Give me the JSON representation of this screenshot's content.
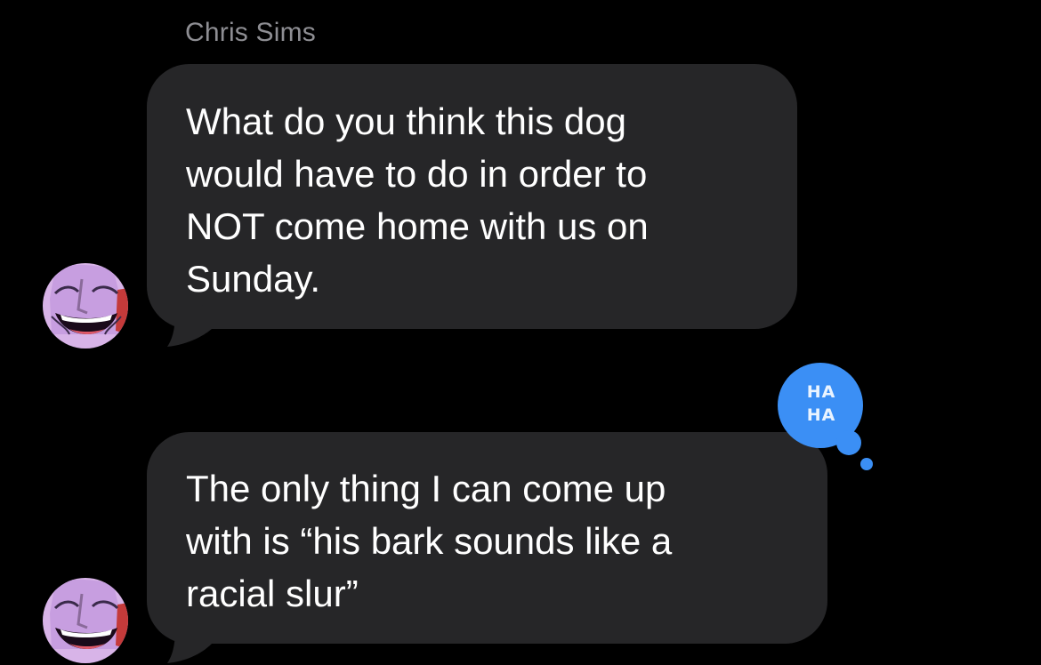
{
  "conversation": {
    "sender_name": "Chris Sims",
    "messages": [
      {
        "text": "What do you think this dog\nwould have to do in order to\nNOT come home with us on\nSunday.",
        "avatar": "contact-avatar"
      },
      {
        "text": "The only thing I can come up\nwith is “his bark sounds like a\nracial slur”",
        "avatar": "contact-avatar",
        "tapback": {
          "line1": "HA",
          "line2": "HA",
          "type": "haha",
          "color": "#3b8ff5"
        }
      }
    ]
  },
  "colors": {
    "background": "#000000",
    "bubble": "#262628",
    "text": "#ffffff",
    "sender_name": "#8e8e93",
    "tapback": "#3b8ff5"
  }
}
